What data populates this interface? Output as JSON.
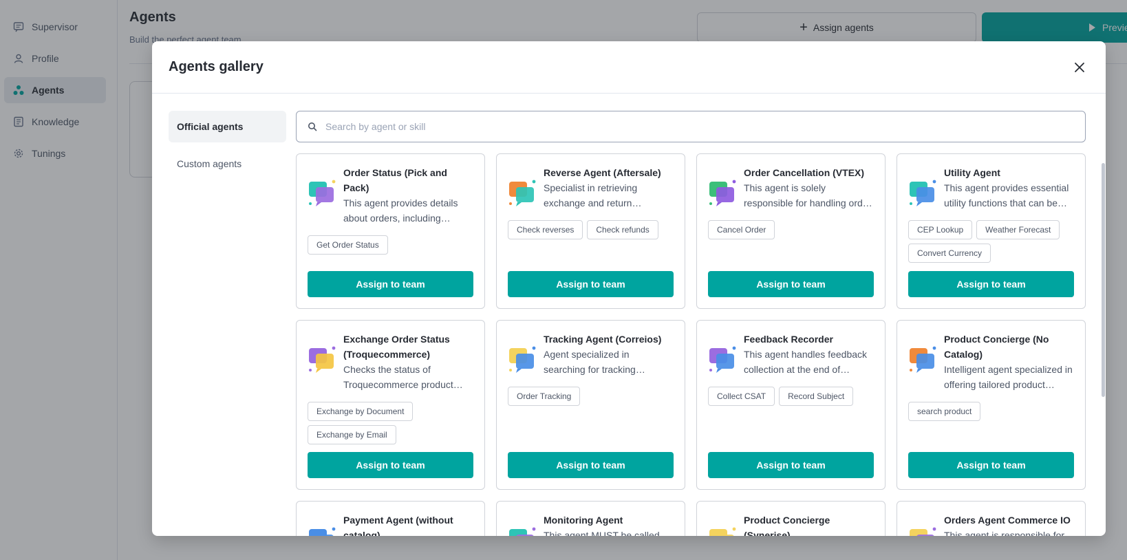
{
  "sidebar": {
    "items": [
      {
        "label": "Supervisor",
        "icon": "chat-icon",
        "active": false
      },
      {
        "label": "Profile",
        "icon": "user-icon",
        "active": false
      },
      {
        "label": "Agents",
        "icon": "agents-icon",
        "active": true
      },
      {
        "label": "Knowledge",
        "icon": "book-icon",
        "active": false
      },
      {
        "label": "Tunings",
        "icon": "gear-icon",
        "active": false
      }
    ]
  },
  "page": {
    "title": "Agents",
    "subtitle": "Build the perfect agent team",
    "assign_agents_label": "Assign agents",
    "preview_label": "Preview"
  },
  "modal": {
    "title": "Agents gallery",
    "tabs": [
      {
        "label": "Official agents",
        "active": true
      },
      {
        "label": "Custom agents",
        "active": false
      }
    ],
    "search_placeholder": "Search by agent or skill",
    "assign_label": "Assign to team",
    "agents": [
      {
        "name": "Order Status (Pick and Pack)",
        "description": "This agent provides details about orders, including tracking and status.",
        "skills": [
          "Get Order Status"
        ],
        "icon_colors": [
          "#2ec4b6",
          "#9b6de0",
          "#f4d35e"
        ]
      },
      {
        "name": "Reverse Agent (Aftersale)",
        "description": "Specialist in retrieving exchange and return information.",
        "skills": [
          "Check reverses",
          "Check refunds"
        ],
        "icon_colors": [
          "#f08a3c",
          "#2ec4b6",
          "#2ec4b6"
        ]
      },
      {
        "name": "Order Cancellation (VTEX)",
        "description": "This agent is solely responsible for handling order cancellation requests.",
        "skills": [
          "Cancel Order"
        ],
        "icon_colors": [
          "#3cbf7a",
          "#8e5be0",
          "#8e5be0"
        ]
      },
      {
        "name": "Utility Agent",
        "description": "This agent provides essential utility functions that can be used anywhere.",
        "skills": [
          "CEP Lookup",
          "Weather Forecast",
          "Convert Currency"
        ],
        "icon_colors": [
          "#2ec4b6",
          "#4a8ee6",
          "#4a8ee6"
        ]
      },
      {
        "name": "Exchange Order Status (Troquecommerce)",
        "description": "Checks the status of Troquecommerce product exchanges.",
        "skills": [
          "Exchange by Document",
          "Exchange by Email"
        ],
        "icon_colors": [
          "#9b6de0",
          "#f4c542",
          "#9b6de0"
        ]
      },
      {
        "name": "Tracking Agent (Correios)",
        "description": "Agent specialized in searching for tracking information from Correios.",
        "skills": [
          "Order Tracking"
        ],
        "icon_colors": [
          "#f4d35e",
          "#4a8ee6",
          "#4a8ee6"
        ]
      },
      {
        "name": "Feedback Recorder",
        "description": "This agent handles feedback collection at the end of conversations.",
        "skills": [
          "Collect CSAT",
          "Record Subject"
        ],
        "icon_colors": [
          "#9b6de0",
          "#4a8ee6",
          "#4a8ee6"
        ]
      },
      {
        "name": "Product Concierge (No Catalog)",
        "description": "Intelligent agent specialized in offering tailored product recommendations.",
        "skills": [
          "search product"
        ],
        "icon_colors": [
          "#f08a3c",
          "#4a8ee6",
          "#4a8ee6"
        ]
      },
      {
        "name": "Payment Agent (without catalog)",
        "description": "",
        "skills": [],
        "icon_colors": [
          "#4a8ee6",
          "#4a8ee6",
          "#4a8ee6"
        ]
      },
      {
        "name": "Monitoring Agent",
        "description": "This agent MUST be called",
        "skills": [],
        "icon_colors": [
          "#2ec4b6",
          "#9b6de0",
          "#9b6de0"
        ]
      },
      {
        "name": "Product Concierge (Synerise)",
        "description": "",
        "skills": [],
        "icon_colors": [
          "#f4d35e",
          "#f4d35e",
          "#f4d35e"
        ]
      },
      {
        "name": "Orders Agent Commerce IO",
        "description": "This agent is responsible for",
        "skills": [],
        "icon_colors": [
          "#f4d35e",
          "#9b6de0",
          "#9b6de0"
        ]
      }
    ]
  },
  "colors": {
    "accent": "#00a49f",
    "overlay": "#272b33",
    "border": "#d0d3d9"
  }
}
